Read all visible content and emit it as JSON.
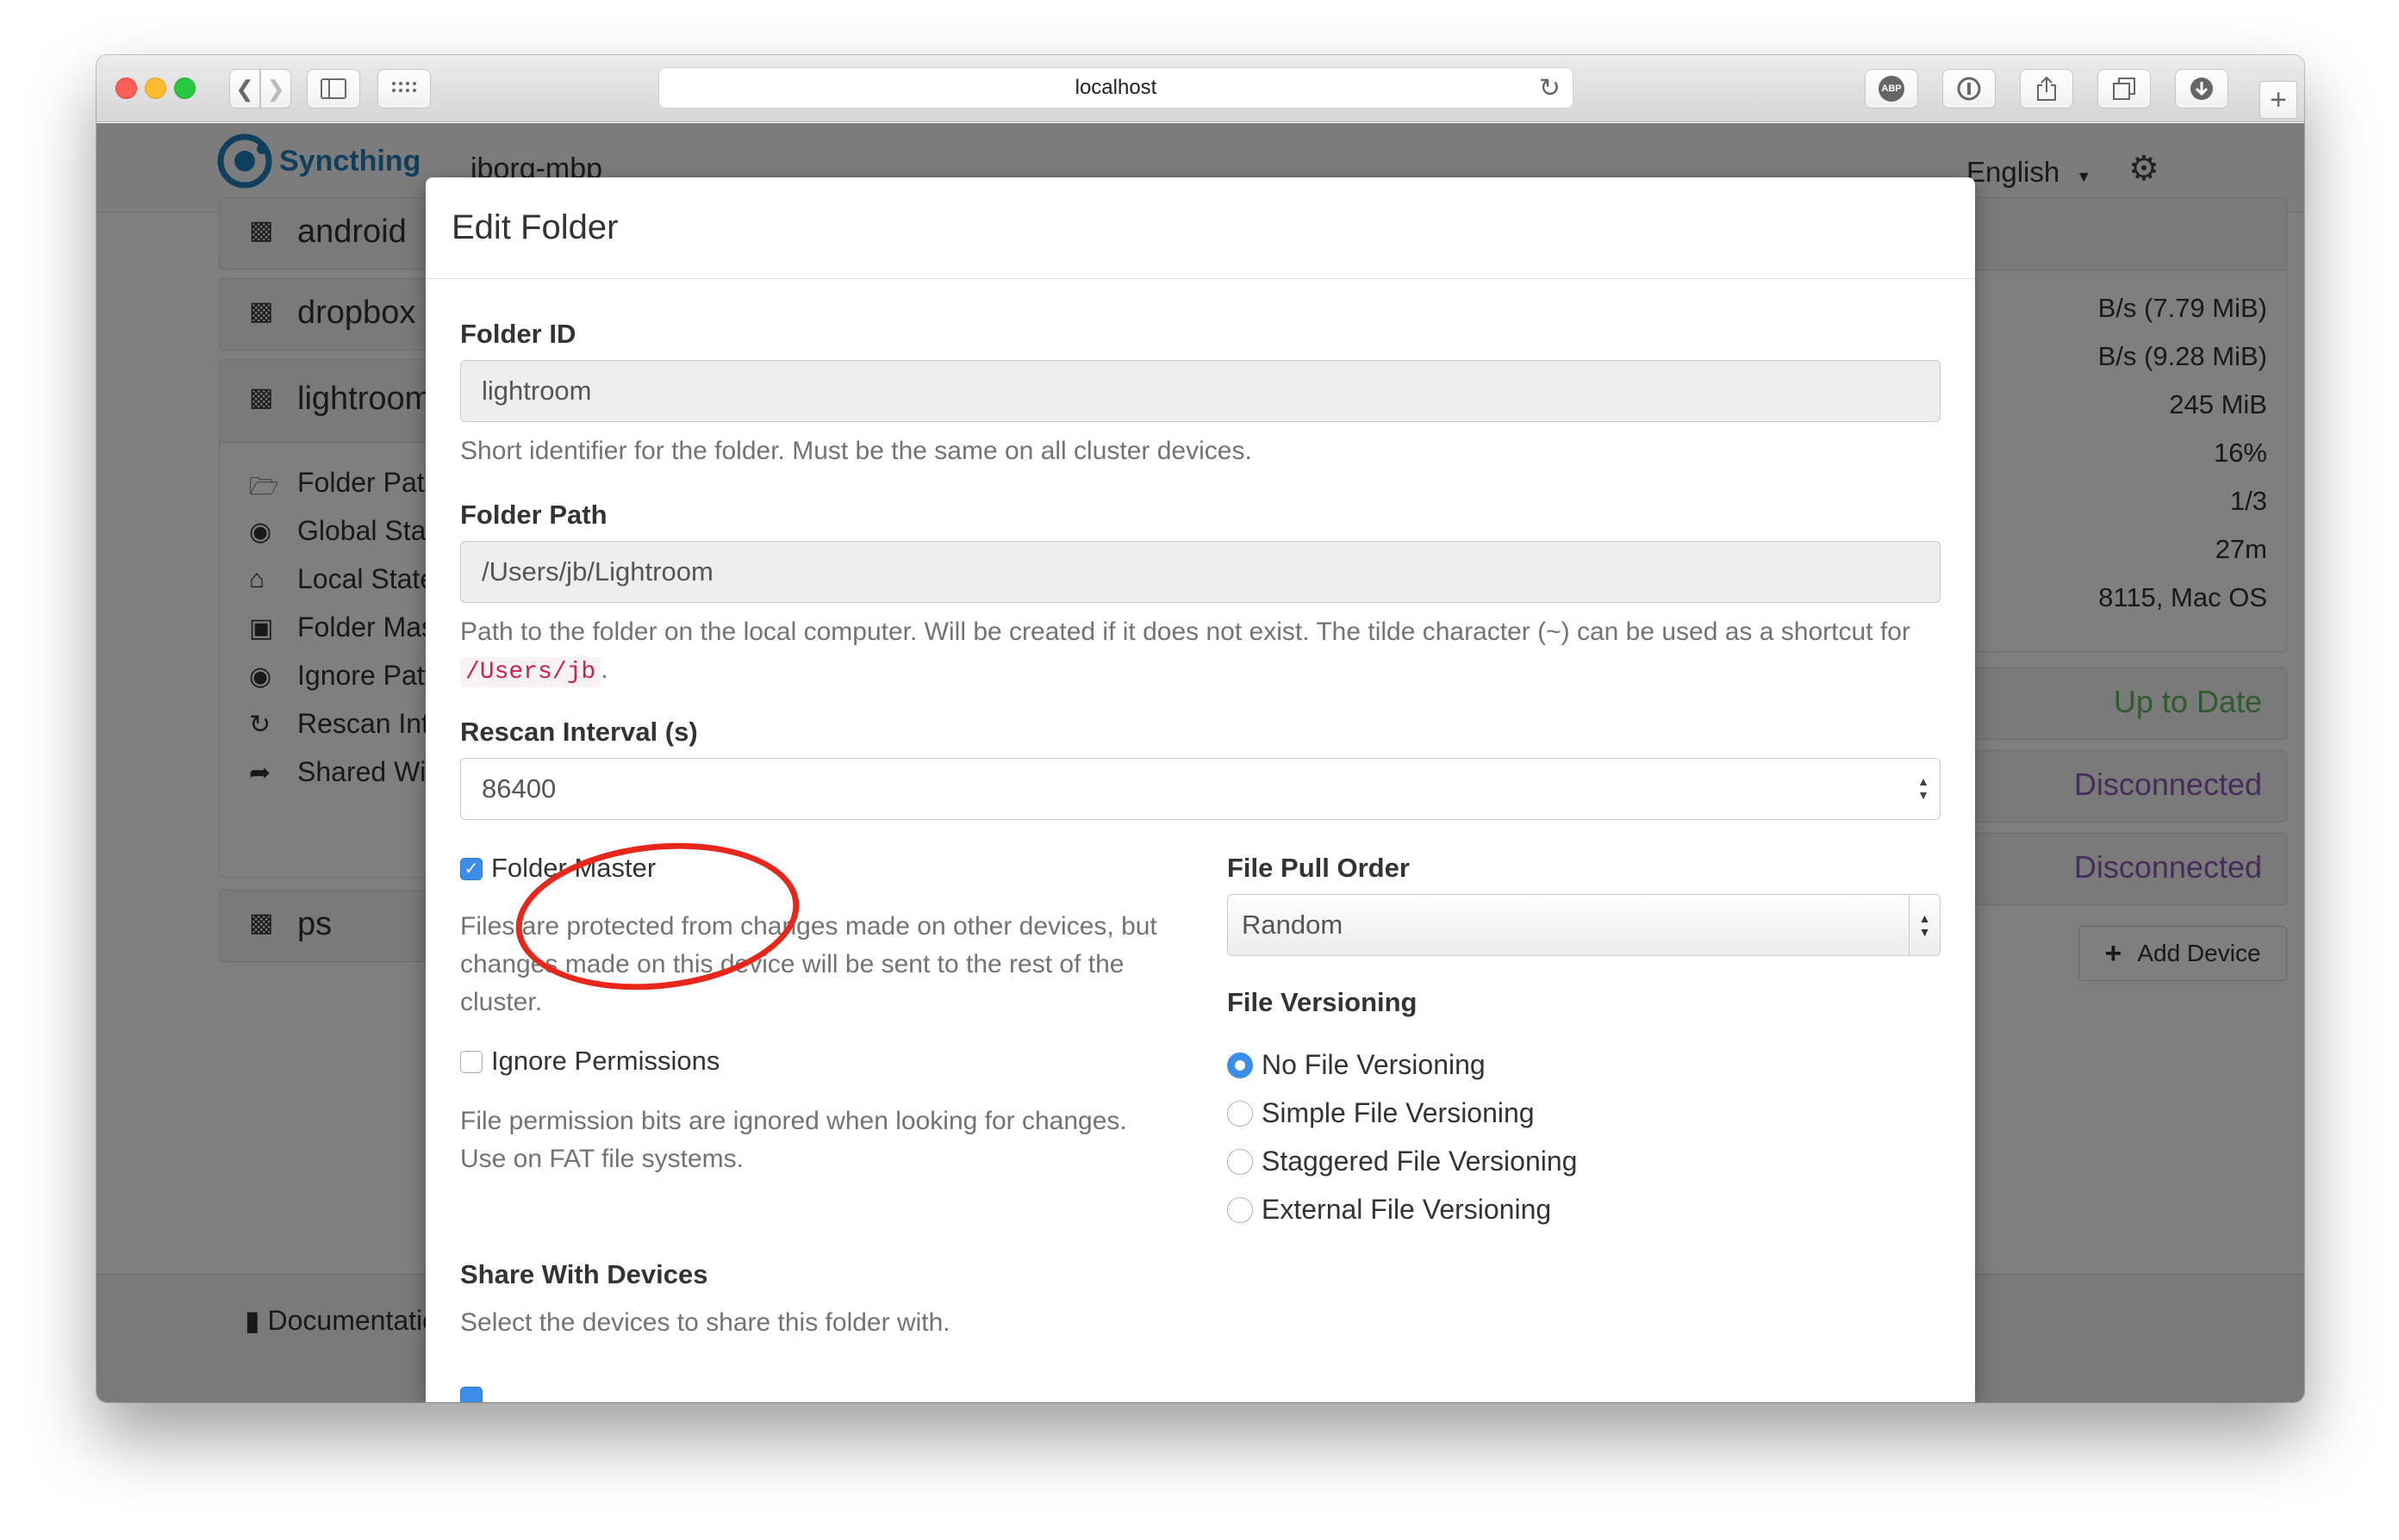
{
  "browser": {
    "address": "localhost",
    "extension_abp": "ABP"
  },
  "app": {
    "brand": "Syncthing",
    "device_name": "jborg-mbp",
    "language": "English"
  },
  "folders": [
    {
      "label": "android"
    },
    {
      "label": "dropbox"
    },
    {
      "label": "lightroom"
    },
    {
      "label": "ps"
    }
  ],
  "folder_detail_rows": [
    {
      "label": "Folder Path",
      "icon": "folder-open-icon"
    },
    {
      "label": "Global State",
      "icon": "globe-icon"
    },
    {
      "label": "Local State",
      "icon": "home-icon"
    },
    {
      "label": "Folder Master",
      "icon": "lock-icon"
    },
    {
      "label": "Ignore Patterns",
      "icon": "eye-slash-icon"
    },
    {
      "label": "Rescan Interval",
      "icon": "refresh-icon"
    },
    {
      "label": "Shared With",
      "icon": "share-icon"
    }
  ],
  "device_stats": [
    "B/s (7.79 MiB)",
    "B/s (9.28 MiB)",
    "245 MiB",
    "16%",
    "1/3",
    "27m",
    "8115, Mac OS"
  ],
  "device_status": [
    {
      "label": "Up to Date",
      "color": "#5cb85c"
    },
    {
      "label": "Disconnected",
      "color": "#8a5db8"
    },
    {
      "label": "Disconnected",
      "color": "#8a5db8"
    }
  ],
  "add_device_label": "Add Device",
  "documentation_label": "Documentation",
  "modal": {
    "title": "Edit Folder",
    "folder_id": {
      "label": "Folder ID",
      "value": "lightroom",
      "help": "Short identifier for the folder. Must be the same on all cluster devices."
    },
    "folder_path": {
      "label": "Folder Path",
      "value": "/Users/jb/Lightroom",
      "help_prefix": "Path to the folder on the local computer. Will be created if it does not exist. The tilde character (~) can be used as a shortcut for",
      "help_code": "/Users/jb",
      "help_suffix": "."
    },
    "rescan_interval": {
      "label": "Rescan Interval (s)",
      "value": "86400"
    },
    "folder_master": {
      "label": "Folder Master",
      "checked": true,
      "help": "Files are protected from changes made on other devices, but changes made on this device will be sent to the rest of the cluster."
    },
    "ignore_permissions": {
      "label": "Ignore Permissions",
      "checked": false,
      "help": "File permission bits are ignored when looking for changes. Use on FAT file systems."
    },
    "file_pull_order": {
      "label": "File Pull Order",
      "selected": "Random"
    },
    "file_versioning": {
      "label": "File Versioning",
      "options": [
        {
          "label": "No File Versioning",
          "selected": true
        },
        {
          "label": "Simple File Versioning",
          "selected": false
        },
        {
          "label": "Staggered File Versioning",
          "selected": false
        },
        {
          "label": "External File Versioning",
          "selected": false
        }
      ]
    },
    "share_with_devices": {
      "label": "Share With Devices",
      "help": "Select the devices to share this folder with."
    }
  },
  "colors": {
    "accent": "#3b8de9",
    "annotation": "#e6271a",
    "brand": "#1e7fb8"
  }
}
